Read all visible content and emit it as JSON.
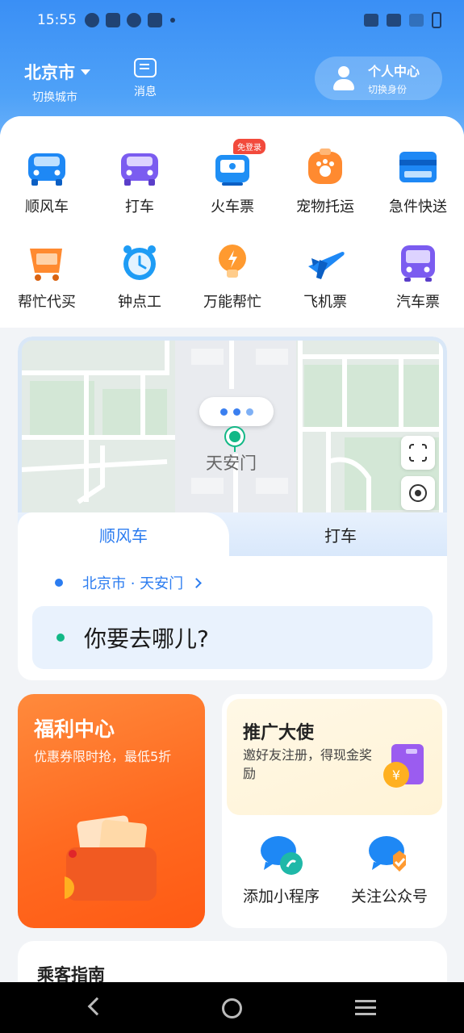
{
  "status_bar": {
    "time": "15:55"
  },
  "header": {
    "city": "北京市",
    "city_sub": "切换城市",
    "message_label": "消息",
    "profile_title": "个人中心",
    "profile_sub": "切换身份"
  },
  "services": [
    {
      "label": "顺风车",
      "icon": "car-icon",
      "color": "#1e88f5"
    },
    {
      "label": "打车",
      "icon": "taxi-icon",
      "color": "#7b5cf0"
    },
    {
      "label": "火车票",
      "icon": "train-icon",
      "color": "#1f8ff5",
      "badge": "免登录"
    },
    {
      "label": "宠物托运",
      "icon": "pet-icon",
      "color": "#ff8a30"
    },
    {
      "label": "急件快送",
      "icon": "card-icon",
      "color": "#1e88f5"
    },
    {
      "label": "帮忙代买",
      "icon": "cart-icon",
      "color": "#ff8a30"
    },
    {
      "label": "钟点工",
      "icon": "clock-icon",
      "color": "#1e9cf5"
    },
    {
      "label": "万能帮忙",
      "icon": "bulb-icon",
      "color": "#ff9a30"
    },
    {
      "label": "飞机票",
      "icon": "plane-icon",
      "color": "#1e88f5"
    },
    {
      "label": "汽车票",
      "icon": "bus-icon",
      "color": "#7b5cf0"
    }
  ],
  "map": {
    "place": "天安门"
  },
  "booking": {
    "tabs": [
      "顺风车",
      "打车"
    ],
    "from": "北京市 · 天安门",
    "to_placeholder": "你要去哪儿?"
  },
  "welfare": {
    "title": "福利中心",
    "subtitle": "优惠券限时抢，最低5折"
  },
  "promo": {
    "title": "推广大使",
    "subtitle": "邀好友注册，得现金奖励"
  },
  "mini_actions": [
    {
      "label": "添加小程序",
      "icon": "mini-program-icon"
    },
    {
      "label": "关注公众号",
      "icon": "official-account-icon"
    }
  ],
  "guide": {
    "title": "乘客指南"
  }
}
